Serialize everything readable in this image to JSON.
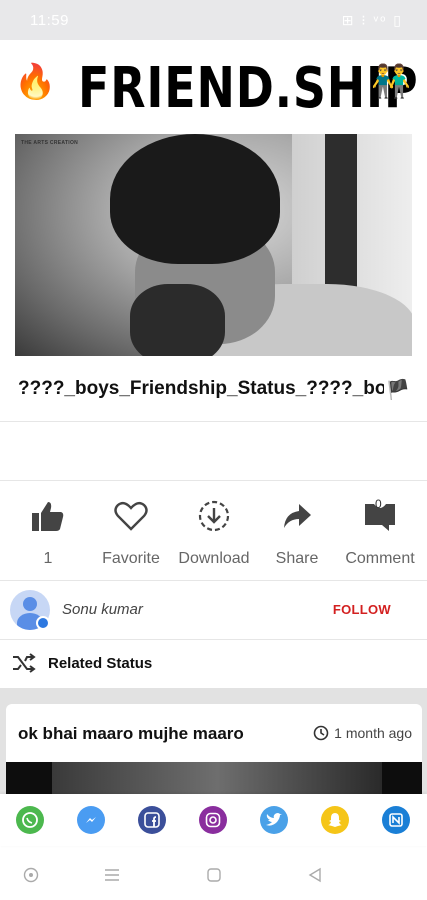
{
  "status_bar": {
    "time": "11:59",
    "icons_text": "⊞ ⁝ ᵛᵒ ▯"
  },
  "banner": {
    "title": "FRIEND.SHIP",
    "left_emoji": "🔥",
    "right_emoji": "👬"
  },
  "video": {
    "watermark": "THE ARTS CREATION",
    "title": "????_boys_Friendship_Status_????_bo",
    "title_flag": "🏴"
  },
  "actions": [
    {
      "name": "like",
      "label": "1",
      "icon": "thumbs-up-icon"
    },
    {
      "name": "favorite",
      "label": "Favorite",
      "icon": "heart-icon"
    },
    {
      "name": "download",
      "label": "Download",
      "icon": "download-icon"
    },
    {
      "name": "share",
      "label": "Share",
      "icon": "share-arrow-icon"
    },
    {
      "name": "comment",
      "label": "Comment",
      "icon": "comment-icon",
      "badge": "0"
    }
  ],
  "user": {
    "name": "Sonu kumar",
    "follow_label": "FOLLOW"
  },
  "related": {
    "label": "Related Status"
  },
  "feed_card": {
    "title": "ok bhai maaro mujhe maaro",
    "time": "1 month ago"
  },
  "share_apps": [
    {
      "name": "whatsapp",
      "color": "#4cb84e"
    },
    {
      "name": "messenger",
      "color": "#4a9cf2"
    },
    {
      "name": "facebook",
      "color": "#3b4f9a"
    },
    {
      "name": "instagram",
      "color": "#8a2e9e"
    },
    {
      "name": "twitter",
      "color": "#4aa1e8"
    },
    {
      "name": "snapchat",
      "color": "#f5c518"
    },
    {
      "name": "other",
      "color": "#1a7fd6"
    }
  ],
  "colors": {
    "accent_red": "#d32020",
    "status_bar_bg": "#e8e8ea",
    "feed_bg": "#e2e2e2"
  }
}
